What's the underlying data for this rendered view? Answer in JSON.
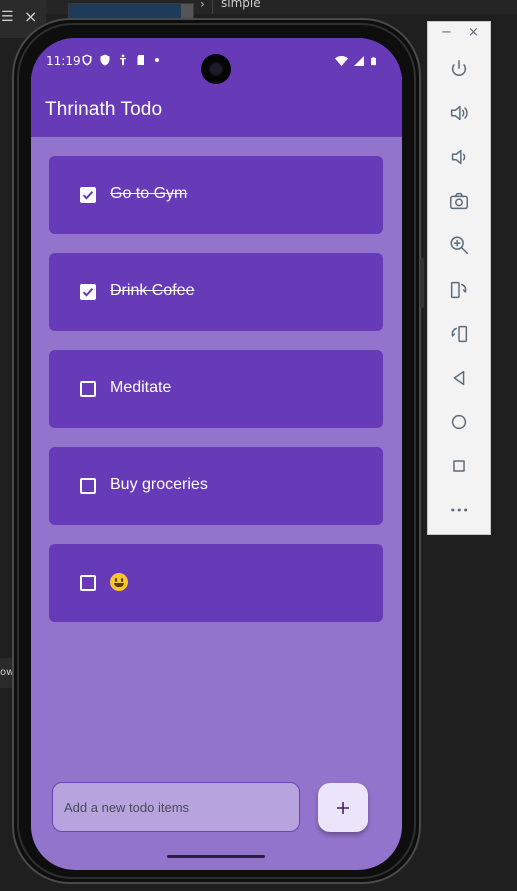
{
  "ide": {
    "breadcrumb": "simple",
    "left_strip_text": "owe"
  },
  "emulator_toolbar": {
    "minimize_label": "−",
    "close_label": "×",
    "buttons": [
      "power-icon",
      "volume-up-icon",
      "volume-down-icon",
      "camera-icon",
      "zoom-in-icon",
      "rotate-left-icon",
      "rotate-right-icon",
      "back-icon",
      "home-icon",
      "overview-icon",
      "more-icon"
    ]
  },
  "status_bar": {
    "time": "11:19"
  },
  "app": {
    "title": "Thrinath Todo",
    "primary_color": "#673ab7",
    "background_color": "#9274cc"
  },
  "todos": [
    {
      "text": "Go to Gym",
      "done": true
    },
    {
      "text": "Drink Cofee",
      "done": true
    },
    {
      "text": "Meditate",
      "done": false
    },
    {
      "text": "Buy groceries",
      "done": false
    },
    {
      "text": "😃",
      "done": false
    }
  ],
  "add_field": {
    "placeholder": "Add a new todo items",
    "value": ""
  },
  "add_button": {
    "icon": "plus-icon"
  }
}
